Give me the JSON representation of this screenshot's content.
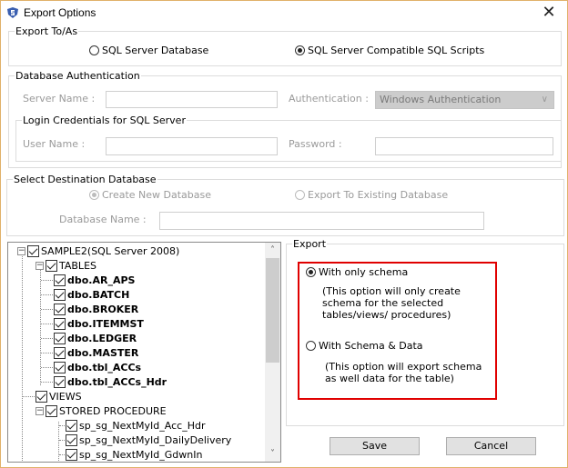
{
  "window": {
    "title": "Export Options",
    "app_icon": "shield-app-icon",
    "close_icon": "close-icon",
    "close_glyph": "✕"
  },
  "export_to_as": {
    "legend": "Export To/As",
    "options": [
      {
        "label": "SQL Server Database",
        "selected": false
      },
      {
        "label": "SQL Server Compatible SQL Scripts",
        "selected": true
      }
    ]
  },
  "database_authentication": {
    "legend": "Database Authentication",
    "server_name_label": "Server Name :",
    "server_name_value": "",
    "authentication_label": "Authentication :",
    "authentication_value": "Windows Authentication",
    "chevron_glyph": "∨",
    "login_credentials": {
      "legend": "Login Credentials for SQL Server",
      "user_name_label": "User Name :",
      "user_name_value": "",
      "password_label": "Password :",
      "password_value": ""
    }
  },
  "destination": {
    "legend": "Select Destination Database",
    "options": [
      {
        "label": "Create New Database",
        "selected": true,
        "disabled": true
      },
      {
        "label": "Export To Existing Database",
        "selected": false,
        "disabled": true
      }
    ],
    "database_name_label": "Database Name :",
    "database_name_value": ""
  },
  "tree": {
    "root": "SAMPLE2(SQL Server 2008)",
    "tables_label": "TABLES",
    "tables": [
      "dbo.AR_APS",
      "dbo.BATCH",
      "dbo.BROKER",
      "dbo.ITEMMST",
      "dbo.LEDGER",
      "dbo.MASTER",
      "dbo.tbl_ACCs",
      "dbo.tbl_ACCs_Hdr"
    ],
    "views_label": "VIEWS",
    "procedures_label": "STORED PROCEDURE",
    "procedures": [
      "sp_sg_NextMyId_Acc_Hdr",
      "sp_sg_NextMyId_DailyDelivery",
      "sp_sg_NextMyId_GdwnIn"
    ],
    "expand_glyph": "−",
    "scroll_up_glyph": "˄",
    "scroll_down_glyph": "˅"
  },
  "export": {
    "legend": "Export",
    "highlight_color": "#e00000",
    "options": [
      {
        "label": "With only schema",
        "selected": true,
        "description": [
          "(This option will only create",
          "schema for the selected",
          "tables/views/ procedures)"
        ]
      },
      {
        "label": "With Schema & Data",
        "selected": false,
        "description": [
          "(This option will export schema",
          "as well data for the table)"
        ]
      }
    ]
  },
  "buttons": {
    "save": "Save",
    "cancel": "Cancel"
  }
}
